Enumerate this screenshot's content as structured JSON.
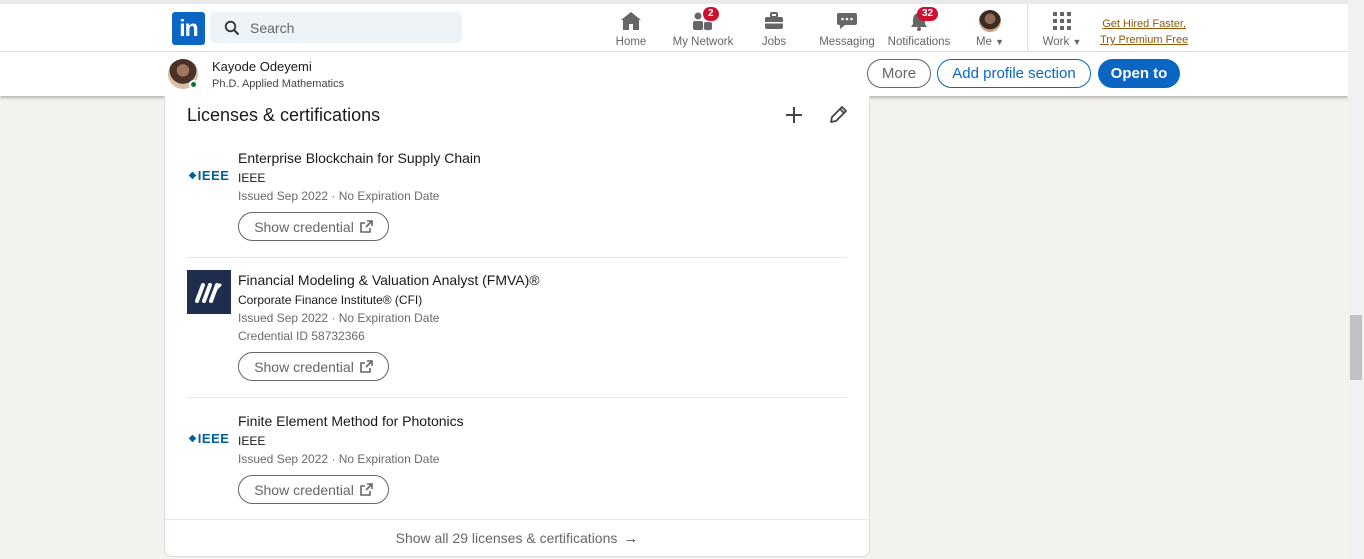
{
  "nav": {
    "logo_text": "in",
    "search_placeholder": "Search",
    "items": [
      {
        "label": "Home",
        "icon": "home-icon"
      },
      {
        "label": "My Network",
        "icon": "network-icon",
        "badge": "2"
      },
      {
        "label": "Jobs",
        "icon": "briefcase-icon"
      },
      {
        "label": "Messaging",
        "icon": "messaging-icon"
      },
      {
        "label": "Notifications",
        "icon": "bell-icon",
        "badge": "32"
      },
      {
        "label": "Me",
        "icon": "avatar"
      },
      {
        "label": "Work",
        "icon": "grid-icon"
      }
    ],
    "premium_line1": "Get Hired Faster,",
    "premium_line2": "Try Premium Free"
  },
  "profile_bar": {
    "name": "Kayode Odeyemi",
    "headline": "Ph.D. Applied Mathematics",
    "more_label": "More",
    "add_section_label": "Add profile section",
    "open_to_label": "Open to"
  },
  "licenses": {
    "title": "Licenses & certifications",
    "items": [
      {
        "name": "Enterprise Blockchain for Supply Chain",
        "issuer": "IEEE",
        "issued": "Issued Sep 2022 · No Expiration Date",
        "credential_id": "",
        "logo": "IEEE",
        "button": "Show credential"
      },
      {
        "name": "Financial Modeling & Valuation Analyst (FMVA)®",
        "issuer": "Corporate Finance Institute® (CFI)",
        "issued": "Issued Sep 2022 · No Expiration Date",
        "credential_id": "Credential ID 58732366",
        "logo": "CFI",
        "button": "Show credential"
      },
      {
        "name": "Finite Element Method for Photonics",
        "issuer": "IEEE",
        "issued": "Issued Sep 2022 · No Expiration Date",
        "credential_id": "",
        "logo": "IEEE",
        "button": "Show credential"
      }
    ],
    "show_all": "Show all 29 licenses & certifications"
  },
  "colors": {
    "brand": "#0a66c2",
    "badge": "#cb112d",
    "premium": "#915907",
    "background": "#f3f2ef"
  }
}
